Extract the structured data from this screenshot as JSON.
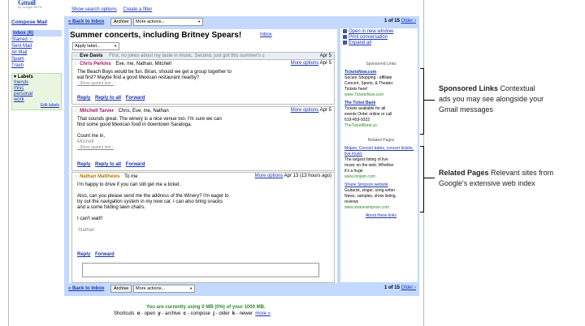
{
  "logo": {
    "text": "Gmail",
    "sub": "by Google BETA"
  },
  "top_links": [
    "Show search options",
    "Create a filter"
  ],
  "sidebar": {
    "compose": "Compose Mail",
    "nav": [
      "Inbox (6)",
      "Starred ☆",
      "Sent Mail",
      "All Mail",
      "Spam",
      "Trash"
    ],
    "labels_header": "▾ Labels",
    "labels": [
      "friends",
      "misc",
      "personal",
      "work"
    ],
    "edit_labels": "Edit labels"
  },
  "toolbar": {
    "back": "« Back to Inbox",
    "archive": "Archive",
    "more_actions": "More actions...",
    "more_actions_arrow": "▼",
    "count_top": "1 of 15",
    "older": "Older ›",
    "count_bottom": "1 of 15",
    "older_bottom": "Older ›"
  },
  "thread": {
    "subject": "Summer concerts, including Britney Spears!",
    "label": "Inbox",
    "apply_label": "Apply label...",
    "messages": [
      {
        "sender": "Eve Davis",
        "snippet": "First, no jokes about my taste in music. Second, just got this summer's c",
        "date": "Apr 5"
      },
      {
        "sender": "Chris Perkins",
        "recipients": "Eve, me, Nathan, Mitchell",
        "more_options": "More options",
        "date": "Apr 5",
        "body": [
          "The Beach Boys would be fun.  Brian, should we get a group together to",
          "eat first?  Maybe find a good Mexican restaurant nearby?"
        ],
        "quoted": "- Show quoted text -",
        "actions": [
          "Reply",
          "Reply to all",
          "Forward"
        ]
      },
      {
        "sender": "Mitchell Tarver",
        "recipients": "Chris, Eve, me, Nathan",
        "more_options": "More options",
        "date": "Apr 5",
        "body": [
          "That sounds great.  The winery is a nice venue too.  I'm sure we can",
          "find some good Mexican food in downtown Saratoga."
        ],
        "sig": [
          "Count me in,",
          "Mitchell"
        ],
        "quoted": "- Show quoted text -",
        "actions": [
          "Reply",
          "Reply to all",
          "Forward"
        ]
      },
      {
        "sender": "Nathan Matthews",
        "recipients": "To me",
        "more_options": "More options",
        "date": "Apr 13 (13 hours ago)",
        "body": [
          "I'm happy to drive if you can still get me a ticket.",
          "",
          "Also, can you please send me the address of the Winery?  I'm eager to",
          "try out the navigation system in my new car.  I can also bring snacks",
          "and a some folding lawn chairs.",
          "",
          "I can't wait!!",
          "",
          "-Nathan"
        ],
        "actions": [
          "Reply",
          "Forward"
        ]
      }
    ]
  },
  "right_panel": {
    "links": [
      "Open in new window",
      "Print conversation",
      "Expand all"
    ],
    "sponsored_header": "Sponsored Links",
    "ads": [
      {
        "title": "TicketsNow.com",
        "lines": [
          "Secure Shopping - affiliate",
          "Concert, Sports, & Theater",
          "Tickets here!"
        ],
        "url": "www.TicketsNow.com"
      },
      {
        "title": "The Ticket Bank",
        "lines": [
          "Tickets available for all",
          "events Order online or call",
          "619-459-9322"
        ],
        "url": "TheTicketBank.us"
      }
    ],
    "related_header": "Related Pages",
    "related": [
      {
        "title": "Mojam, Concert dates, concert tickets, live music",
        "lines": [
          "The largest listing of live",
          "music on the web. Whether",
          "it's a huge"
        ],
        "url": "www.mojam.com"
      },
      {
        "title": "Shane Simpson website",
        "lines": [
          "Guitarist, singer, song-writer",
          "News, samples, show listing,",
          "reviews"
        ],
        "url": "www.shanesimpson.com"
      }
    ],
    "about": "About these links"
  },
  "footer": {
    "usage": "You are currently using 0 MB (0%) of your 1000 MB.",
    "shortcuts_label": "Shortcuts",
    "shortcuts": [
      {
        "key": "o",
        "action": "open"
      },
      {
        "key": "y",
        "action": "archive"
      },
      {
        "key": "c",
        "action": "compose"
      },
      {
        "key": "j",
        "action": "older"
      },
      {
        "key": "k",
        "action": "newer"
      }
    ],
    "more": "more »"
  },
  "annotations": {
    "sponsored_title": "Sponsored Links",
    "sponsored_text": [
      "Contextual",
      "ads you may see alongside your",
      "Gmail messages"
    ],
    "related_title": "Related Pages",
    "related_text": [
      "Relevant sites from",
      "Google's extensive web index"
    ]
  }
}
